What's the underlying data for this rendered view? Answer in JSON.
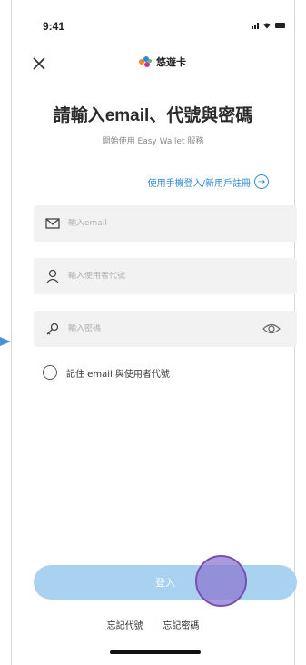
{
  "status_bar": {
    "time": "9:41"
  },
  "header": {
    "logo_text": "悠遊卡"
  },
  "title": "請輸入email、代號與密碼",
  "subtitle": "開始使用 Easy Wallet 服務",
  "phone_login_link": "使用手機登入/新用戶註冊",
  "fields": {
    "email_placeholder": "輸入email",
    "user_id_placeholder": "輸入使用者代號",
    "password_placeholder": "輸入密碼"
  },
  "remember_label": "記住 email 與使用者代號",
  "login_button": "登入",
  "footer": {
    "forgot_id": "忘記代號",
    "separator": "|",
    "forgot_password": "忘記密碼"
  },
  "colors": {
    "accent": "#2d8ad6",
    "button": "#a9d2f0",
    "touch": "#8c78d2"
  }
}
